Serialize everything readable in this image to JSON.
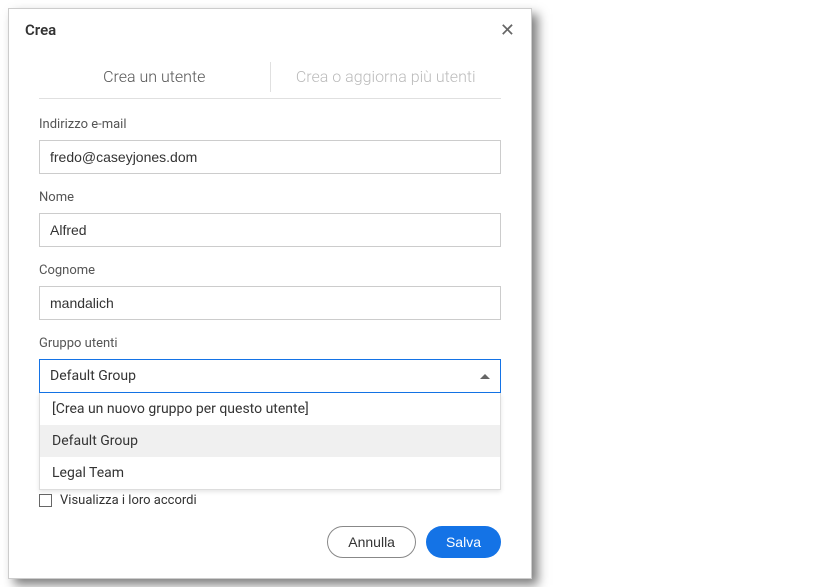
{
  "header": {
    "title": "Crea"
  },
  "tabs": {
    "create_user": "Crea un utente",
    "create_bulk": "Crea o aggiorna più utenti"
  },
  "fields": {
    "email": {
      "label": "Indirizzo e-mail",
      "value": "fredo@caseyjones.dom"
    },
    "firstname": {
      "label": "Nome",
      "value": "Alfred"
    },
    "lastname": {
      "label": "Cognome",
      "value": "mandalich"
    },
    "group": {
      "label": "Gruppo utenti",
      "selected": "Default Group",
      "options": [
        "[Crea un nuovo gruppo per questo utente]",
        "Default Group",
        "Legal Team"
      ]
    }
  },
  "checkbox": {
    "label": "Visualizza i loro accordi"
  },
  "footer": {
    "cancel": "Annulla",
    "save": "Salva"
  }
}
